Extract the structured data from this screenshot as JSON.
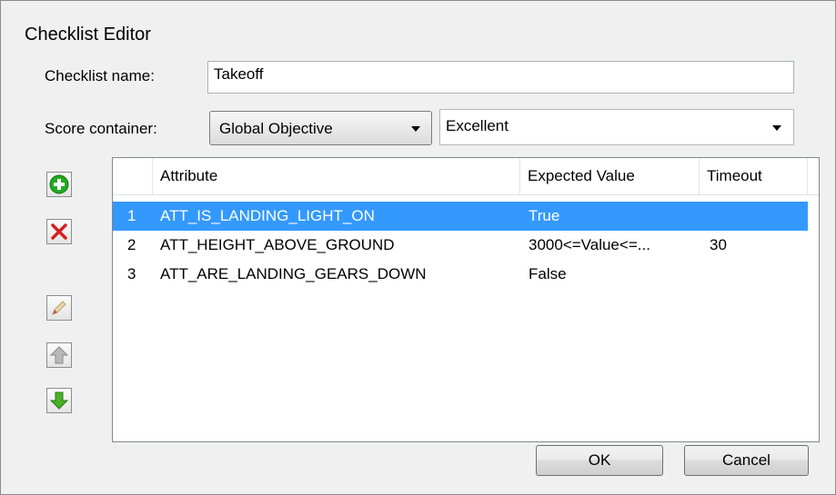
{
  "window": {
    "title": "Checklist Editor"
  },
  "form": {
    "name_label": "Checklist name:",
    "name_value": "Takeoff",
    "score_label": "Score container:",
    "score_container": "Global Objective",
    "score_value": "Excellent"
  },
  "toolbar": {
    "add_icon": "add-icon",
    "delete_icon": "delete-icon",
    "edit_icon": "edit-icon",
    "move_up_icon": "move-up-icon",
    "move_down_icon": "move-down-icon"
  },
  "table": {
    "columns": [
      "Attribute",
      "Expected Value",
      "Timeout"
    ],
    "rows": [
      {
        "num": "1",
        "attribute": "ATT_IS_LANDING_LIGHT_ON",
        "expected": "True",
        "timeout": ""
      },
      {
        "num": "2",
        "attribute": "ATT_HEIGHT_ABOVE_GROUND",
        "expected": "3000<=Value<=...",
        "timeout": "30"
      },
      {
        "num": "3",
        "attribute": "ATT_ARE_LANDING_GEARS_DOWN",
        "expected": "False",
        "timeout": ""
      }
    ],
    "selected_row": 0
  },
  "buttons": {
    "ok": "OK",
    "cancel": "Cancel"
  },
  "colors": {
    "selection": "#3399ff",
    "add_green": "#22aa22",
    "delete_red": "#d42020"
  }
}
